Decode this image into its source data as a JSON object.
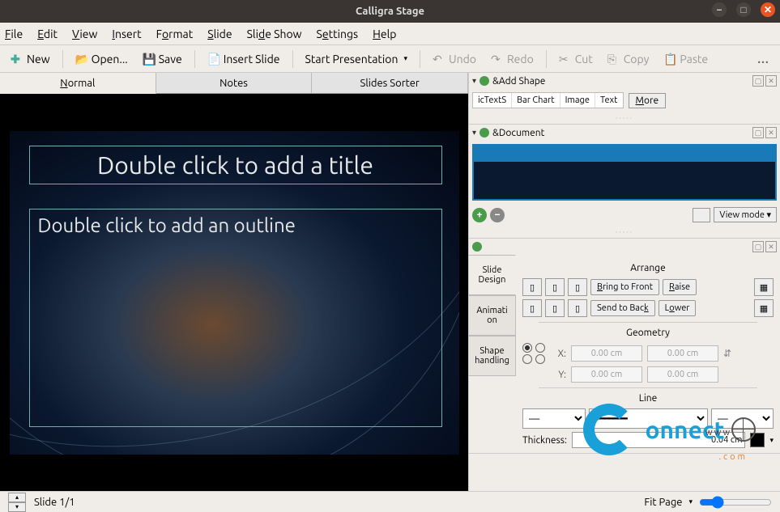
{
  "window": {
    "title": "Calligra Stage"
  },
  "menu": {
    "file": "File",
    "edit": "Edit",
    "view": "View",
    "insert": "Insert",
    "format": "Format",
    "slide": "Slide",
    "slideshow": "Slide Show",
    "settings": "Settings",
    "help": "Help"
  },
  "toolbar": {
    "new": "New",
    "open": "Open...",
    "save": "Save",
    "insert_slide": "Insert Slide",
    "start_pres": "Start Presentation",
    "undo": "Undo",
    "redo": "Redo",
    "cut": "Cut",
    "copy": "Copy",
    "paste": "Paste",
    "more": "…"
  },
  "viewtabs": {
    "normal": "Normal",
    "notes": "Notes",
    "sorter": "Slides Sorter"
  },
  "slide": {
    "title_ph": "Double click to add a title",
    "outline_ph": "Double click to add an outline"
  },
  "panels": {
    "add_shape": {
      "title": "&Add Shape",
      "item1": "icTextS",
      "item2": "Bar Chart",
      "item3": "Image",
      "item4": "Text",
      "more": "More"
    },
    "document": {
      "title": "&Document",
      "view_mode": "View mode"
    },
    "props": {
      "tab_slide": "Slide Design",
      "tab_anim": "Animation",
      "tab_shape": "Shape handling",
      "arrange": "Arrange",
      "bring_front": "Bring to Front",
      "raise": "Raise",
      "send_back": "Send to Back",
      "lower": "Lower",
      "geometry": "Geometry",
      "x_label": "X:",
      "y_label": "Y:",
      "x_val": "0.00 cm",
      "y_val": "0.00 cm",
      "w_val": "0.00 cm",
      "h_val": "0.00 cm",
      "line": "Line",
      "thickness_label": "Thickness:",
      "thickness_val": "0.04 cm"
    }
  },
  "status": {
    "slide": "Slide 1/1",
    "fit": "Fit Page"
  },
  "watermark": {
    "brand": "onnect",
    "sub": ".com",
    "www": "www"
  }
}
